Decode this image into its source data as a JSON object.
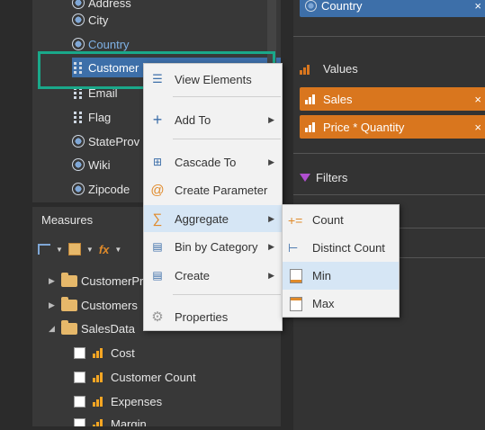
{
  "dimensions": {
    "items": [
      {
        "label": "Address",
        "icon": "globe-icon"
      },
      {
        "label": "City",
        "icon": "globe-icon"
      },
      {
        "label": "Country",
        "icon": "globe-icon"
      },
      {
        "label": "Customer",
        "icon": "hierarchy-icon"
      },
      {
        "label": "Email",
        "icon": "hierarchy-icon"
      },
      {
        "label": "Flag",
        "icon": "image-icon"
      },
      {
        "label": "StateProv",
        "icon": "globe-icon"
      },
      {
        "label": "Wiki",
        "icon": "globe-icon"
      },
      {
        "label": "Zipcode",
        "icon": "globe-icon"
      }
    ],
    "selected_index": 3
  },
  "measures": {
    "header": "Measures",
    "toolbar": {
      "fx_label": "fx"
    },
    "folders": [
      {
        "label": "CustomerPr",
        "expanded": false
      },
      {
        "label": "Customers",
        "expanded": false
      },
      {
        "label": "SalesData",
        "expanded": true
      }
    ],
    "items": [
      {
        "label": "Cost"
      },
      {
        "label": "Customer Count"
      },
      {
        "label": "Expenses"
      },
      {
        "label": "Margin"
      }
    ]
  },
  "right_panel": {
    "rows_pill": {
      "label": "Country",
      "close": "×"
    },
    "values_title": "Values",
    "values": [
      {
        "label": "Sales",
        "close": "×"
      },
      {
        "label": "Price * Quantity",
        "close": "×"
      }
    ],
    "filters_title": "Filters"
  },
  "context_menu": {
    "items": [
      {
        "label": "View Elements",
        "icon": "list-icon",
        "has_submenu": false
      },
      {
        "label": "Add To",
        "icon": "plus-icon",
        "has_submenu": true
      },
      {
        "label": "Cascade To",
        "icon": "cascade-icon",
        "has_submenu": true
      },
      {
        "label": "Create Parameter",
        "icon": "at-icon",
        "has_submenu": false
      },
      {
        "label": "Aggregate",
        "icon": "sigma-icon",
        "has_submenu": true
      },
      {
        "label": "Bin by Category",
        "icon": "bin-icon",
        "has_submenu": true
      },
      {
        "label": "Create",
        "icon": "create-icon",
        "has_submenu": true
      },
      {
        "label": "Properties",
        "icon": "gear-icon",
        "has_submenu": false
      }
    ],
    "arrow_glyph": "▶"
  },
  "aggregate_submenu": {
    "items": [
      {
        "label": "Count",
        "icon": "count-icon"
      },
      {
        "label": "Distinct Count",
        "icon": "distinct-count-icon"
      },
      {
        "label": "Min",
        "icon": "min-icon"
      },
      {
        "label": "Max",
        "icon": "max-icon"
      }
    ],
    "active_index": 2
  },
  "colors": {
    "selection_blue": "#3d6fa9",
    "highlight_teal": "#1aa88a",
    "value_orange": "#d9761e",
    "menu_active": "#d6e6f5"
  }
}
